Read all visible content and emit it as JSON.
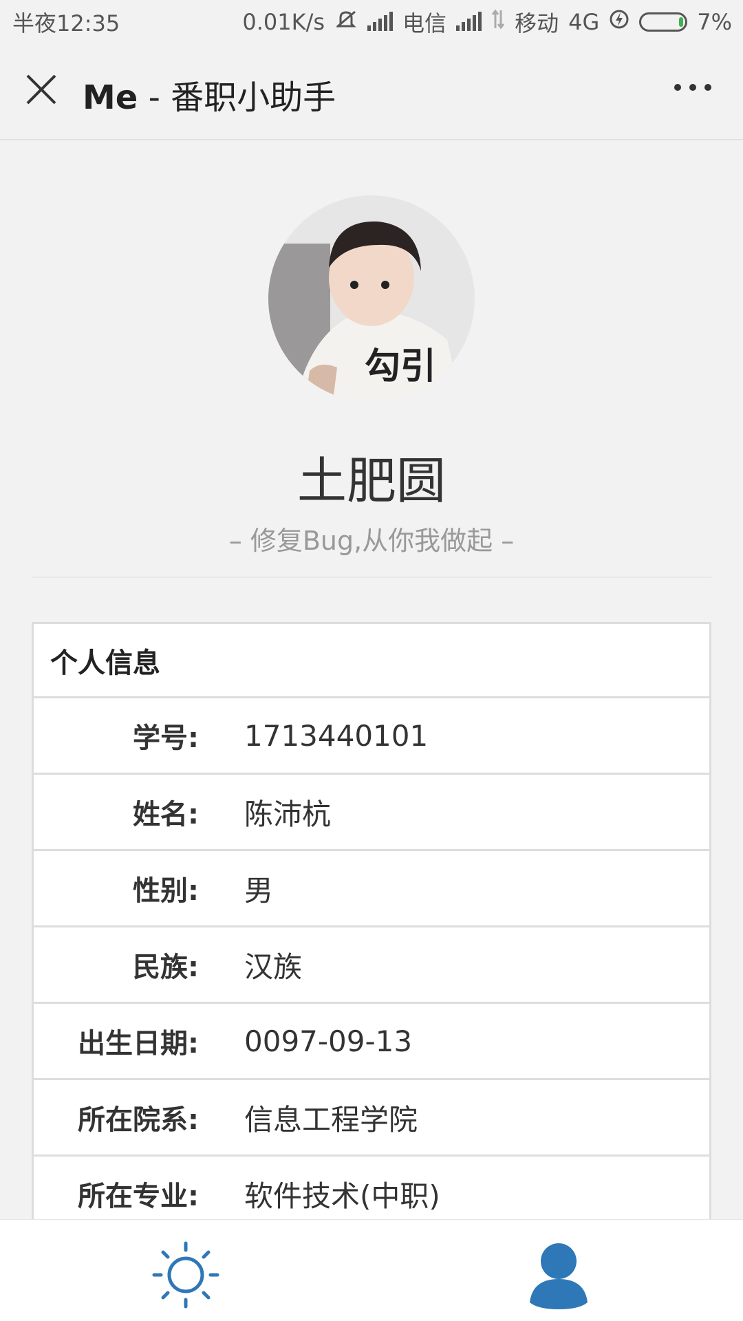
{
  "status_bar": {
    "time": "半夜12:35",
    "net_speed": "0.01K/s",
    "carrier1": "电信",
    "carrier2": "移动",
    "network_type": "4G",
    "battery": "7%"
  },
  "title_bar": {
    "title_bold": "Me",
    "title_rest": " - 番职小助手",
    "icons": [
      "close-icon",
      "more-icon"
    ]
  },
  "profile": {
    "avatar_caption": "勾引",
    "nickname": "土肥圆",
    "motto": "– 修复Bug,从你我做起 –"
  },
  "info": {
    "header": "个人信息",
    "rows": [
      {
        "label": "学号:",
        "value": "1713440101"
      },
      {
        "label": "姓名:",
        "value": "陈沛杭"
      },
      {
        "label": "性别:",
        "value": "男"
      },
      {
        "label": "民族:",
        "value": "汉族"
      },
      {
        "label": "出生日期:",
        "value": "0097-09-13"
      },
      {
        "label": "所在院系:",
        "value": "信息工程学院"
      },
      {
        "label": "所在专业:",
        "value": "软件技术(中职)"
      }
    ]
  },
  "bottom_nav": {
    "icons": [
      "sun-icon",
      "person-icon"
    ],
    "accent_color": "#2f78b7"
  }
}
